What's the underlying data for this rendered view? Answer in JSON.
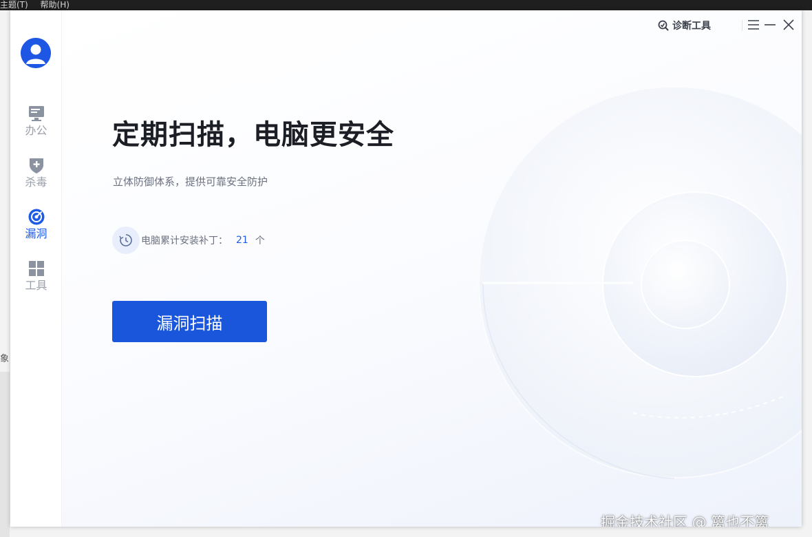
{
  "background": {
    "menu_items": [
      "主题(T)",
      "帮助(H)"
    ],
    "fragment_text": "象"
  },
  "header": {
    "diagnose_tool_label": "诊断工具"
  },
  "sidebar": {
    "items": [
      {
        "label": "办公",
        "icon": "monitor-icon",
        "active": false
      },
      {
        "label": "杀毒",
        "icon": "shield-plus-icon",
        "active": false
      },
      {
        "label": "漏洞",
        "icon": "target-icon",
        "active": true
      },
      {
        "label": "工具",
        "icon": "grid-icon",
        "active": false
      }
    ]
  },
  "main": {
    "headline": "定期扫描，电脑更安全",
    "subline": "立体防御体系，提供可靠安全防护",
    "patch_label": "电脑累计安装补丁：",
    "patch_count": "21",
    "patch_unit": "个",
    "scan_button_label": "漏洞扫描"
  },
  "watermark": "掘金技术社区 @ 篱也不篱",
  "colors": {
    "accent": "#1a56db",
    "active_nav": "#1d5ae6",
    "inactive_nav": "#9aa0ab",
    "headline": "#1b1e24"
  }
}
